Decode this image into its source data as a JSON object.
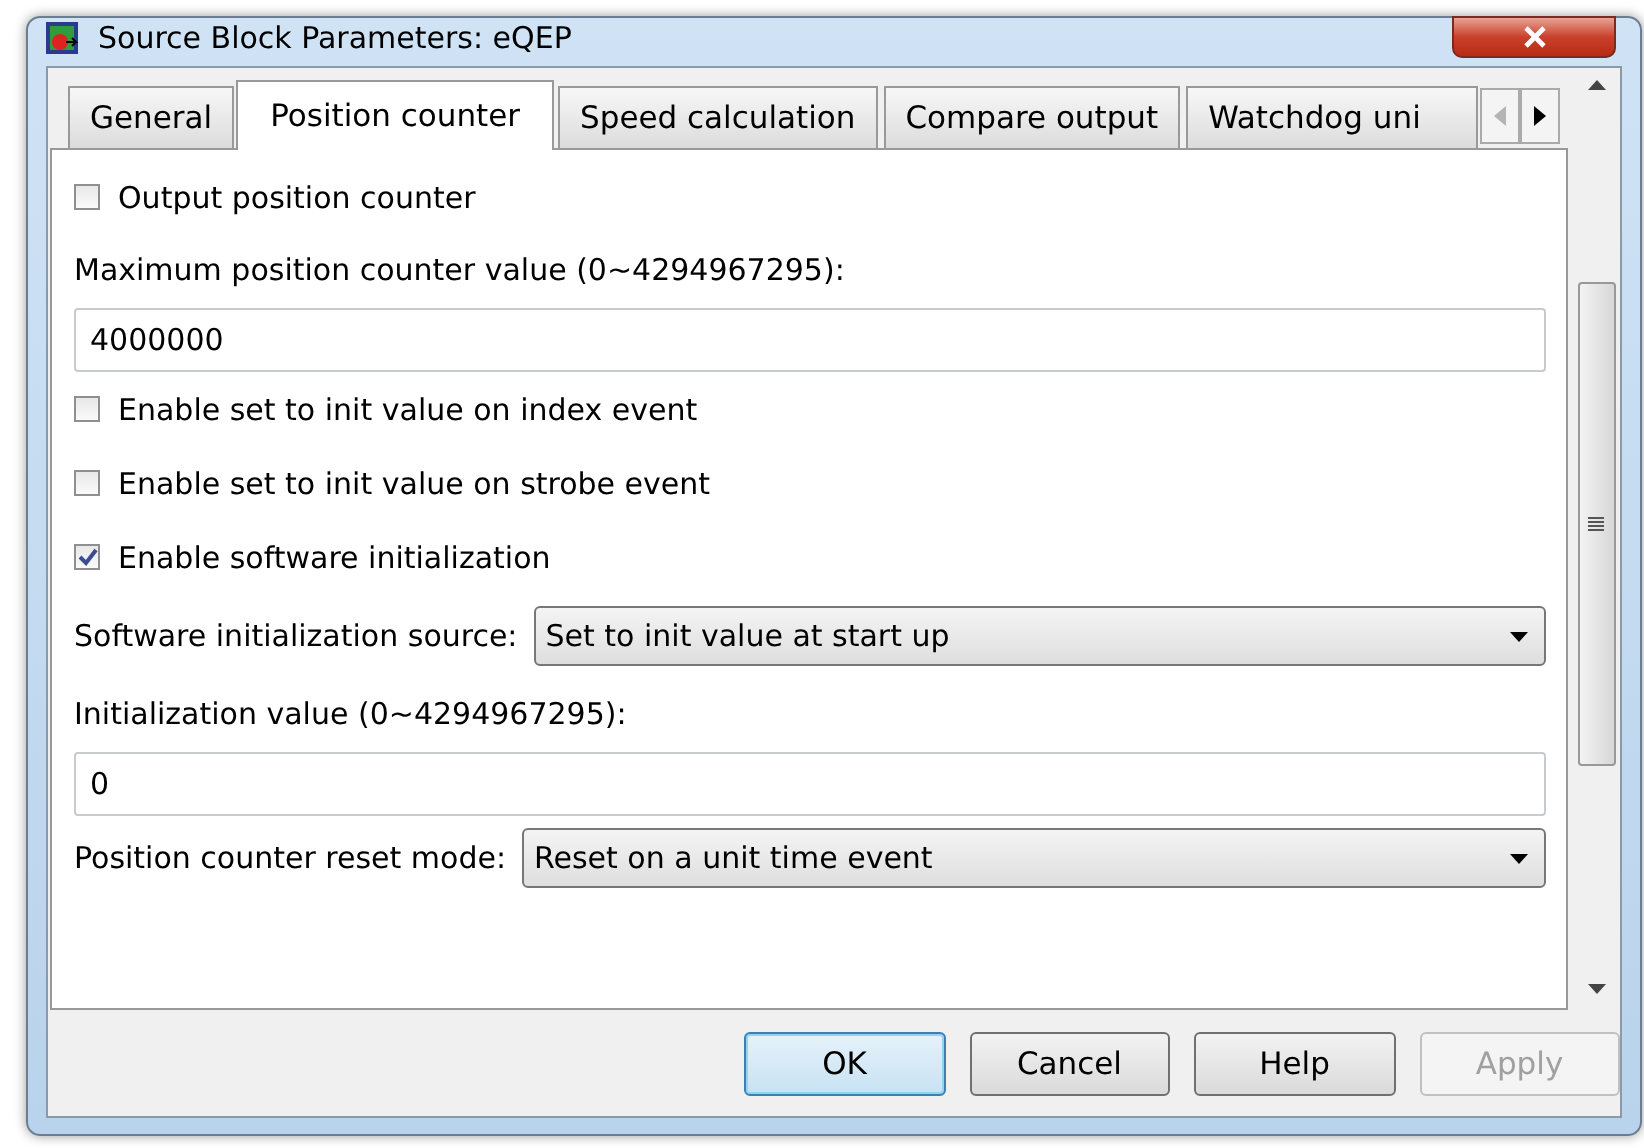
{
  "window": {
    "title": "Source Block Parameters: eQEP"
  },
  "tabs": [
    {
      "label": "General",
      "selected": false
    },
    {
      "label": "Position counter",
      "selected": true
    },
    {
      "label": "Speed calculation",
      "selected": false
    },
    {
      "label": "Compare output",
      "selected": false
    },
    {
      "label": "Watchdog uni",
      "selected": false
    }
  ],
  "tab_scroll": {
    "left_disabled": true,
    "right_disabled": false
  },
  "fields": [
    {
      "kind": "checkbox",
      "label": "Output position counter",
      "checked": false
    },
    {
      "kind": "label",
      "text": "Maximum position counter value (0~4294967295):"
    },
    {
      "kind": "text",
      "value": "4000000"
    },
    {
      "kind": "checkbox",
      "label": "Enable set to init value on index event",
      "checked": false
    },
    {
      "kind": "checkbox",
      "label": "Enable set to init value on strobe event",
      "checked": false
    },
    {
      "kind": "checkbox",
      "label": "Enable software initialization",
      "checked": true
    },
    {
      "kind": "dropdown",
      "label": "Software initialization source:",
      "value": "Set to init value at start up"
    },
    {
      "kind": "label",
      "text": "Initialization value (0~4294967295):"
    },
    {
      "kind": "text",
      "value": "0"
    },
    {
      "kind": "dropdown",
      "label": "Position counter reset mode:",
      "value": "Reset on a unit time event"
    }
  ],
  "buttons": [
    {
      "label": "OK",
      "focused": true,
      "disabled": false
    },
    {
      "label": "Cancel",
      "focused": false,
      "disabled": false
    },
    {
      "label": "Help",
      "focused": false,
      "disabled": false
    },
    {
      "label": "Apply",
      "focused": false,
      "disabled": true
    }
  ]
}
